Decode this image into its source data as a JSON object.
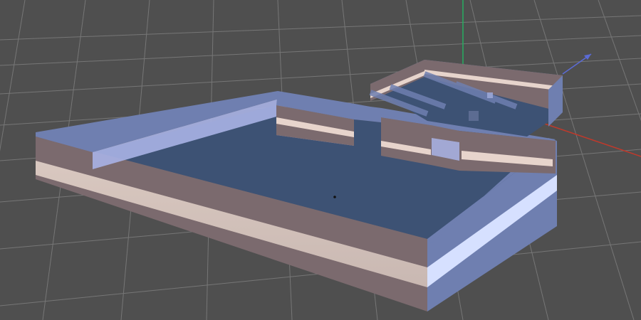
{
  "viewport": {
    "mode": "3d-perspective",
    "background": "#4f4f4f",
    "grid_color": "#7a7a7a",
    "axis_colors": {
      "x": "#c0392b",
      "y": "#27ae60",
      "z": "#5b6bd6"
    }
  },
  "model": {
    "object": "floor-plan-walls-extrusion",
    "wall_colors": {
      "top_edge": "#6f7fb0",
      "face_dark": "#7b6a6e",
      "stripe_light": "#e7d4cc",
      "face_blue": "#a9b3e6",
      "floor": "#3d5274"
    }
  }
}
